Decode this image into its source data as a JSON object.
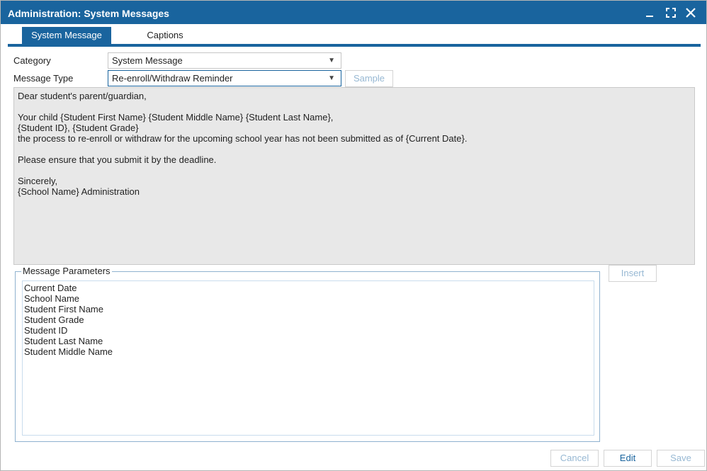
{
  "window": {
    "title": "Administration: System Messages"
  },
  "tabs": [
    {
      "label": "System Message",
      "active": true
    },
    {
      "label": "Captions",
      "active": false
    }
  ],
  "form": {
    "category_label": "Category",
    "category_value": "System Message",
    "message_type_label": "Message Type",
    "message_type_value": "Re-enroll/Withdraw Reminder",
    "sample_button": "Sample"
  },
  "message_body": "Dear student's parent/guardian,\n\nYour child {Student First Name} {Student Middle Name} {Student Last Name},\n{Student ID}, {Student Grade}\nthe process to re-enroll or withdraw for the upcoming school year has not been submitted as of {Current Date}.\n\nPlease ensure that you submit it by the deadline.\n\nSincerely,\n{School Name} Administration",
  "parameters": {
    "legend": "Message Parameters",
    "items": [
      "Current Date",
      "School Name",
      "Student First Name",
      "Student Grade",
      "Student ID",
      "Student Last Name",
      "Student Middle Name"
    ],
    "insert_button": "Insert"
  },
  "footer": {
    "cancel": "Cancel",
    "edit": "Edit",
    "save": "Save"
  },
  "icons": {
    "minimize": "minimize-icon",
    "maximize": "maximize-icon",
    "close": "close-icon",
    "dropdown": "chevron-down-icon"
  },
  "colors": {
    "primary": "#19649e",
    "message_bg": "#e8e8e8",
    "disabled_text": "#97b8d3"
  }
}
